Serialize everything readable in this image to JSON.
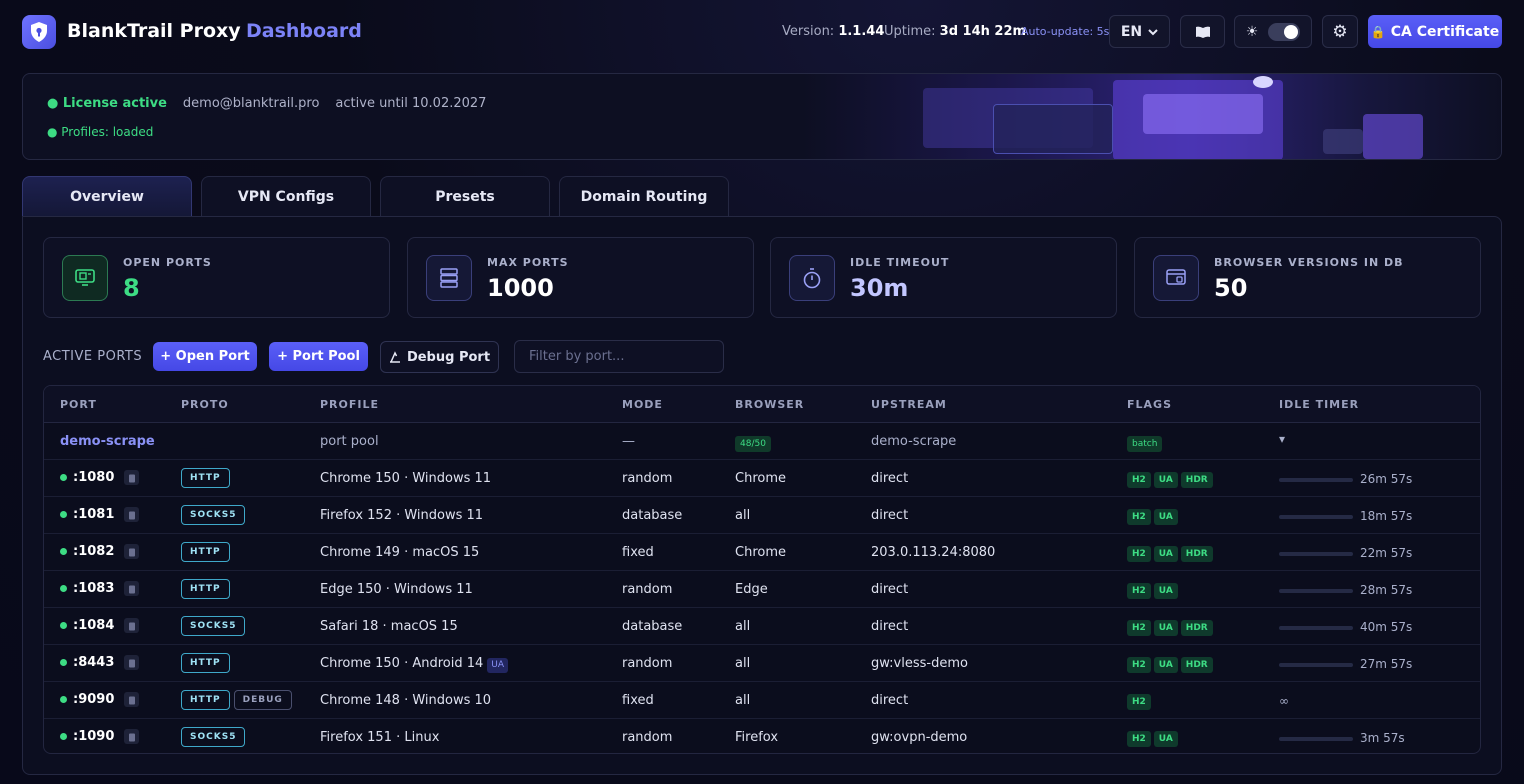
{
  "header": {
    "brand": "BlankTrail Proxy",
    "subtitle": "Dashboard",
    "version_label": "Version:",
    "version": "1.1.44",
    "uptime_label": "Uptime:",
    "uptime": "3d 14h 22m",
    "auto_update": "Auto-update: 5s",
    "language": "EN",
    "ca_button": "CA Certificate"
  },
  "license": {
    "status": "● License active",
    "email": "demo@blanktrail.pro",
    "until": "active until 10.02.2027",
    "profiles": "● Profiles: loaded"
  },
  "tabs": [
    "Overview",
    "VPN Configs",
    "Presets",
    "Domain Routing"
  ],
  "stats": [
    {
      "label": "OPEN PORTS",
      "value": "8",
      "icon": "monitor-icon"
    },
    {
      "label": "MAX PORTS",
      "value": "1000",
      "icon": "server-icon"
    },
    {
      "label": "IDLE TIMEOUT",
      "value": "30m",
      "icon": "stopwatch-icon"
    },
    {
      "label": "BROWSER VERSIONS IN DB",
      "value": "50",
      "icon": "browser-db-icon"
    }
  ],
  "toolbar": {
    "label": "ACTIVE PORTS",
    "open_port": "+ Open Port",
    "port_pool": "+ Port Pool",
    "debug_port": "Debug Port",
    "filter_placeholder": "Filter by port..."
  },
  "table": {
    "columns": [
      "PORT",
      "PROTO",
      "PROFILE",
      "MODE",
      "BROWSER",
      "UPSTREAM",
      "FLAGS",
      "IDLE TIMER"
    ],
    "pool_row": {
      "port": "demo-scrape",
      "profile": "port pool",
      "mode": "—",
      "browser": "48/50",
      "upstream": "demo-scrape",
      "flag": "batch",
      "timer": "▾"
    },
    "rows": [
      {
        "port": ":1080",
        "proto": [
          "HTTP"
        ],
        "profile": "Chrome 150 · Windows 11",
        "ua": "",
        "mode": "random",
        "browser": "Chrome",
        "upstream": "direct",
        "flags": [
          "H2",
          "UA",
          "HDR"
        ],
        "timer": "26m 57s",
        "idle_fraction": 0.0
      },
      {
        "port": ":1081",
        "proto": [
          "SOCKS5"
        ],
        "profile": "Firefox 152 · Windows 11",
        "ua": "",
        "mode": "database",
        "browser": "all",
        "upstream": "direct",
        "flags": [
          "H2",
          "UA"
        ],
        "timer": "18m 57s",
        "idle_fraction": 0.0
      },
      {
        "port": ":1082",
        "proto": [
          "HTTP"
        ],
        "profile": "Chrome 149 · macOS 15",
        "ua": "",
        "mode": "fixed",
        "browser": "Chrome",
        "upstream": "203.0.113.24:8080",
        "flags": [
          "H2",
          "UA",
          "HDR"
        ],
        "timer": "22m 57s",
        "idle_fraction": 0.0
      },
      {
        "port": ":1083",
        "proto": [
          "HTTP"
        ],
        "profile": "Edge 150 · Windows 11",
        "ua": "",
        "mode": "random",
        "browser": "Edge",
        "upstream": "direct",
        "flags": [
          "H2",
          "UA"
        ],
        "timer": "28m 57s",
        "idle_fraction": 0.0
      },
      {
        "port": ":1084",
        "proto": [
          "SOCKS5"
        ],
        "profile": "Safari 18 · macOS 15",
        "ua": "",
        "mode": "database",
        "browser": "all",
        "upstream": "direct",
        "flags": [
          "H2",
          "UA",
          "HDR"
        ],
        "timer": "40m 57s",
        "idle_fraction": 0.0
      },
      {
        "port": ":8443",
        "proto": [
          "HTTP"
        ],
        "profile": "Chrome 150 · Android 14",
        "ua": "UA",
        "mode": "random",
        "browser": "all",
        "upstream": "gw:vless-demo",
        "flags": [
          "H2",
          "UA",
          "HDR"
        ],
        "timer": "27m 57s",
        "idle_fraction": 0.0
      },
      {
        "port": ":9090",
        "proto": [
          "HTTP",
          "DEBUG"
        ],
        "profile": "Chrome 148 · Windows 10",
        "ua": "",
        "mode": "fixed",
        "browser": "all",
        "upstream": "direct",
        "flags": [
          "H2"
        ],
        "timer": "∞",
        "idle_fraction": null
      },
      {
        "port": ":1090",
        "proto": [
          "SOCKS5"
        ],
        "profile": "Firefox 151 · Linux",
        "ua": "",
        "mode": "random",
        "browser": "Firefox",
        "upstream": "gw:ovpn-demo",
        "flags": [
          "H2",
          "UA"
        ],
        "timer": "3m 57s",
        "idle_fraction": 0.0
      }
    ]
  }
}
